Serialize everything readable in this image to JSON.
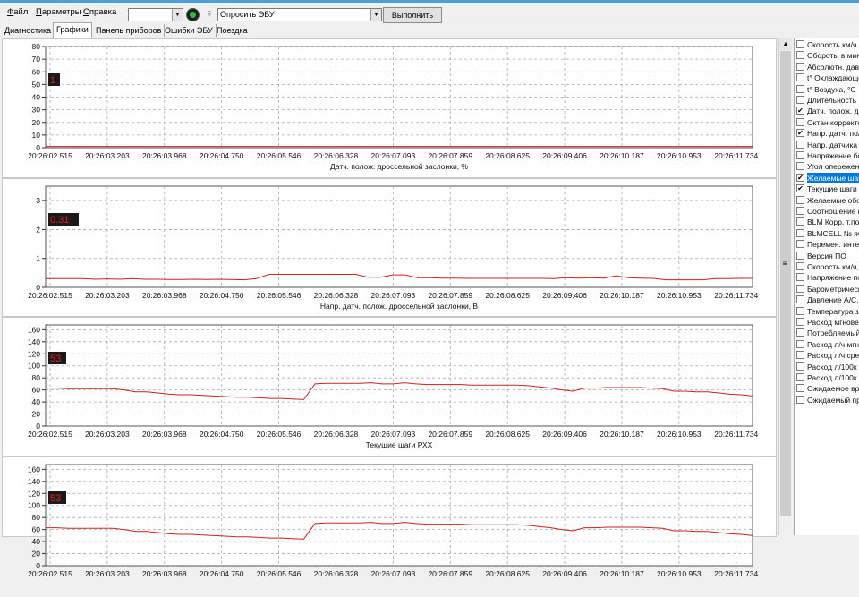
{
  "menu": {
    "items": [
      {
        "underline": "Ф",
        "rest": "айл"
      },
      {
        "underline": "П",
        "rest": "араметры"
      },
      {
        "underline": "С",
        "rest": "правка"
      }
    ]
  },
  "toolbar": {
    "small_combo_value": "",
    "ecu_combo_value": "Опросить ЭБУ",
    "run_label": "Выполнить",
    "indicator_color": "#27c23a"
  },
  "tabs": [
    "Диагностика",
    "Графики",
    "Панель приборов",
    "Ошибки ЭБУ",
    "Поездка"
  ],
  "active_tab": 1,
  "time_ticks": [
    "20:26:02.515",
    "20:26:03.203",
    "20:26:03.968",
    "20:26:04.750",
    "20:26:05.546",
    "20:26:06.328",
    "20:26:07.093",
    "20:26:07.859",
    "20:26:08.625",
    "20:26:09.406",
    "20:26:10.187",
    "20:26:10.953",
    "20:26:11.734"
  ],
  "chart_data": [
    {
      "type": "line",
      "xlabel": "Датч. полож. дроссельной заслонки, %",
      "ylim": [
        0,
        80
      ],
      "yticks": [
        "0",
        "10",
        "20",
        "30",
        "40",
        "50",
        "60",
        "70",
        "80"
      ],
      "current_label": "1",
      "values": [
        1,
        1,
        1,
        1,
        1,
        1,
        1,
        1,
        1,
        1,
        1,
        1,
        1,
        1,
        1,
        1,
        1,
        1,
        1,
        1,
        1,
        1,
        1,
        1,
        1,
        1,
        1,
        1,
        1,
        1,
        1,
        1,
        1,
        1,
        1,
        1,
        1,
        1,
        1,
        1,
        1,
        1,
        1,
        1,
        1,
        1,
        1,
        1,
        1
      ],
      "line_color": "#cc2222"
    },
    {
      "type": "line",
      "xlabel": "Напр. датч. полож. дроссельной заслонки, В",
      "ylim": [
        0,
        3.5
      ],
      "yticks": [
        "0",
        "1",
        "2",
        "3"
      ],
      "current_label": "0.31",
      "values": [
        0.3,
        0.3,
        0.3,
        0.3,
        0.28,
        0.29,
        0.28,
        0.3,
        0.28,
        0.28,
        0.27,
        0.27,
        0.28,
        0.27,
        0.28,
        0.27,
        0.26,
        0.3,
        0.45,
        0.45,
        0.45,
        0.45,
        0.45,
        0.45,
        0.45,
        0.45,
        0.35,
        0.35,
        0.43,
        0.43,
        0.33,
        0.33,
        0.32,
        0.32,
        0.31,
        0.31,
        0.31,
        0.31,
        0.31,
        0.31,
        0.31,
        0.3,
        0.33,
        0.32,
        0.33,
        0.32,
        0.4,
        0.33,
        0.32,
        0.31,
        0.26,
        0.26,
        0.26,
        0.26,
        0.3,
        0.3,
        0.31,
        0.31
      ],
      "line_color": "#cc2222"
    },
    {
      "type": "line",
      "xlabel": "Текущие шаги РХХ",
      "ylim": [
        0,
        168
      ],
      "yticks": [
        "0",
        "20",
        "40",
        "60",
        "80",
        "100",
        "120",
        "140",
        "160"
      ],
      "current_label": "53",
      "values": [
        63,
        63,
        62,
        62,
        62,
        62,
        62,
        60,
        57,
        57,
        55,
        53,
        52,
        52,
        51,
        50,
        49,
        48,
        48,
        47,
        46,
        46,
        45,
        44,
        70,
        71,
        71,
        71,
        71,
        72,
        70,
        70,
        72,
        70,
        69,
        69,
        69,
        69,
        68,
        68,
        68,
        68,
        68,
        67,
        65,
        63,
        60,
        58,
        63,
        63,
        64,
        64,
        64,
        64,
        63,
        62,
        58,
        58,
        57,
        57,
        55,
        53,
        52,
        50
      ],
      "line_color": "#cc2222"
    },
    {
      "type": "line",
      "xlabel": "",
      "ylim": [
        0,
        168
      ],
      "yticks": [
        "0",
        "20",
        "40",
        "60",
        "80",
        "100",
        "120",
        "140",
        "160"
      ],
      "current_label": "53",
      "values": [
        63,
        63,
        62,
        62,
        62,
        62,
        62,
        60,
        57,
        57,
        55,
        53,
        52,
        52,
        51,
        50,
        49,
        48,
        48,
        47,
        46,
        46,
        45,
        44,
        70,
        71,
        71,
        71,
        71,
        72,
        70,
        70,
        72,
        70,
        69,
        69,
        69,
        69,
        68,
        68,
        68,
        68,
        68,
        67,
        65,
        63,
        60,
        58,
        63,
        63,
        64,
        64,
        64,
        64,
        63,
        62,
        58,
        58,
        57,
        57,
        55,
        53,
        52,
        50
      ],
      "line_color": "#cc2222"
    }
  ],
  "params": [
    {
      "label": "Скорость км/ч",
      "checked": false
    },
    {
      "label": "Обороты в мин",
      "checked": false
    },
    {
      "label": "Абсолютн. давл",
      "checked": false
    },
    {
      "label": "t° Охлаждающе",
      "checked": false
    },
    {
      "label": "t° Воздуха, °С",
      "checked": false
    },
    {
      "label": "Длительность",
      "checked": false
    },
    {
      "label": "Датч. полож. д",
      "checked": true
    },
    {
      "label": "Октан корректо",
      "checked": false
    },
    {
      "label": "Напр. датч. пол",
      "checked": true
    },
    {
      "label": "Напр. датчика",
      "checked": false
    },
    {
      "label": "Напряжение бо",
      "checked": false
    },
    {
      "label": "Угол опережен",
      "checked": false
    },
    {
      "label": "Желаемые шаг",
      "checked": true,
      "selected": true
    },
    {
      "label": "Текущие шаги",
      "checked": true
    },
    {
      "label": "Желаемые обо",
      "checked": false
    },
    {
      "label": "Соотношение в",
      "checked": false
    },
    {
      "label": "BLM Корр. т.по",
      "checked": false
    },
    {
      "label": "BLMCELL № яч",
      "checked": false
    },
    {
      "label": "Перемен. интег",
      "checked": false
    },
    {
      "label": "Версия ПО",
      "checked": false
    },
    {
      "label": "Скорость км/ч,",
      "checked": false
    },
    {
      "label": "Напряжение по",
      "checked": false
    },
    {
      "label": "Барометрическ",
      "checked": false
    },
    {
      "label": "Давление А/С,",
      "checked": false
    },
    {
      "label": "Температура з",
      "checked": false
    },
    {
      "label": "Расход мгновен",
      "checked": false
    },
    {
      "label": "Потребляемый",
      "checked": false
    },
    {
      "label": "Расход л/ч мгн",
      "checked": false
    },
    {
      "label": "Расход л/ч сре",
      "checked": false
    },
    {
      "label": "Расход л/100к",
      "checked": false
    },
    {
      "label": "Расход л/100к",
      "checked": false
    },
    {
      "label": "Ожидаемое вре",
      "checked": false
    },
    {
      "label": "Ожидаемый пр",
      "checked": false
    }
  ]
}
